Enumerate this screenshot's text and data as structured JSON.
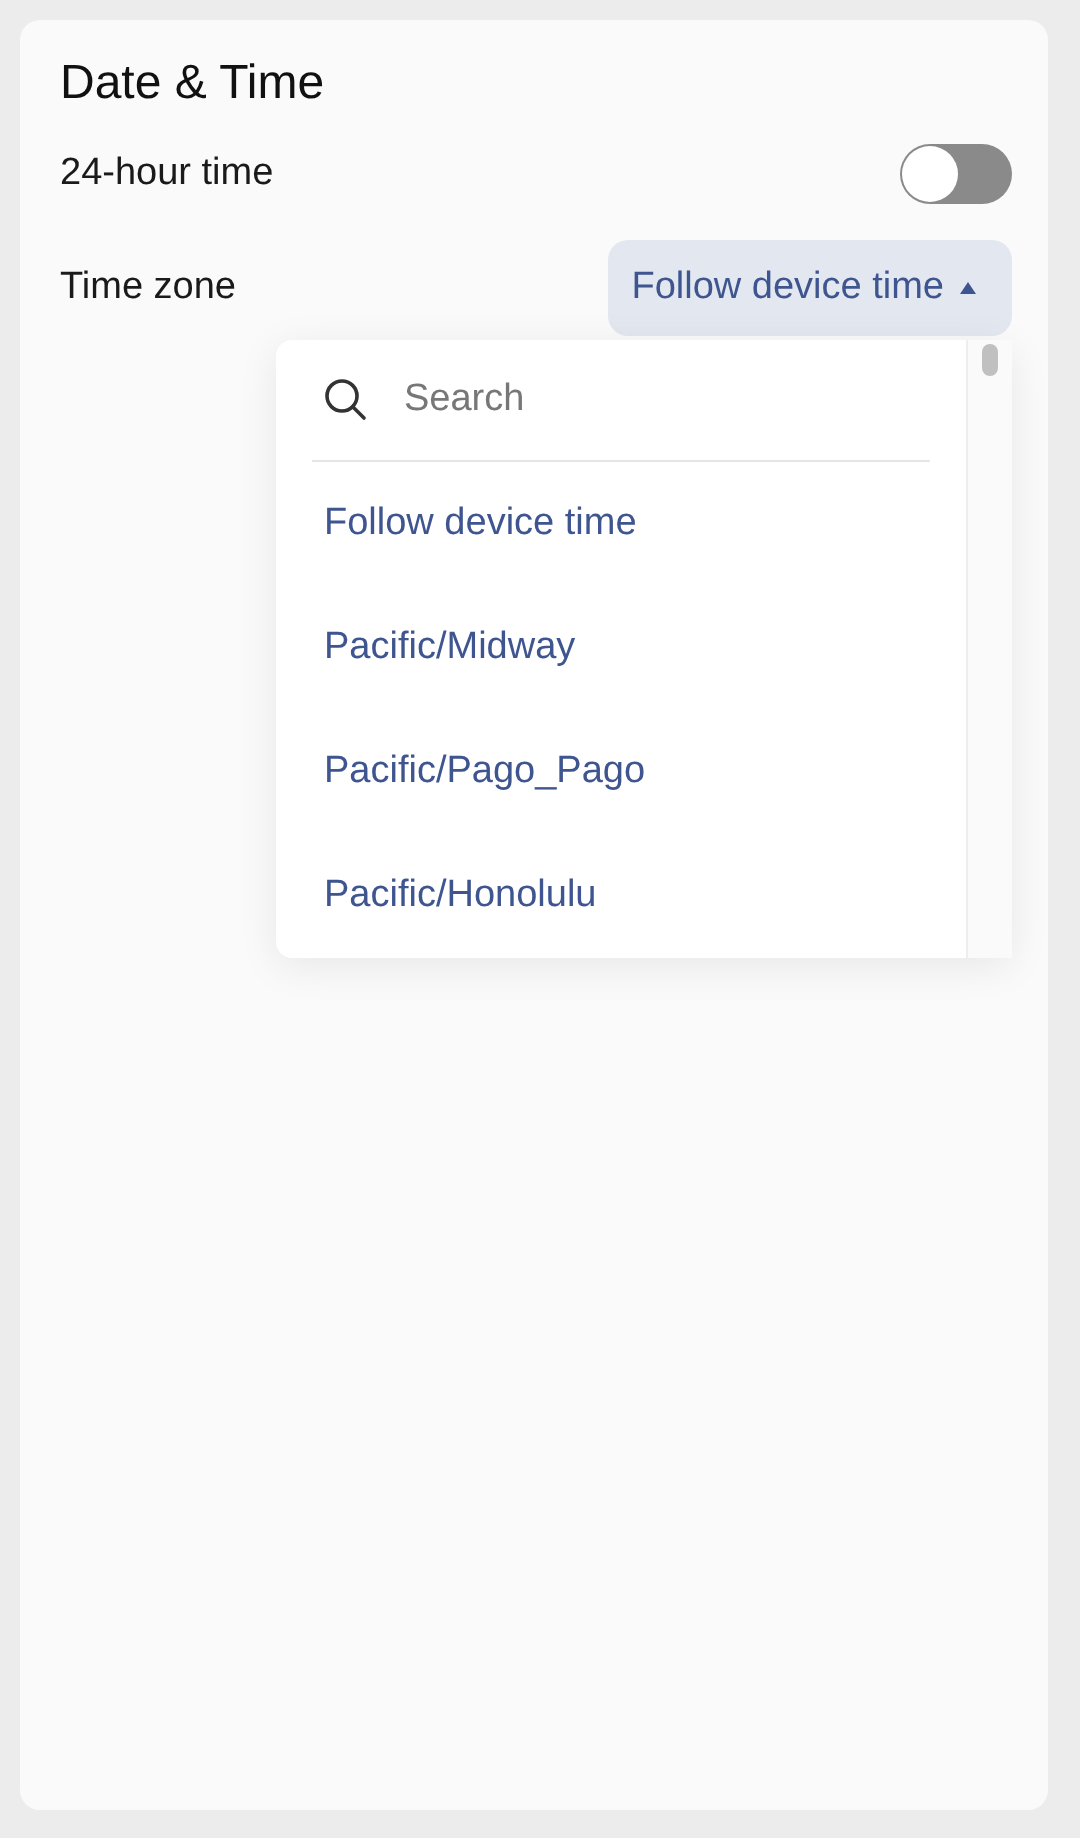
{
  "title": "Date & Time",
  "hour24": {
    "label": "24-hour time",
    "on": false
  },
  "timezone": {
    "label": "Time zone",
    "value": "Follow device time",
    "expanded": true,
    "search": {
      "placeholder": "Search"
    },
    "options": [
      {
        "label": "Follow device time"
      },
      {
        "label": "Pacific/Midway"
      },
      {
        "label": "Pacific/Pago_Pago"
      },
      {
        "label": "Pacific/Honolulu"
      }
    ]
  }
}
